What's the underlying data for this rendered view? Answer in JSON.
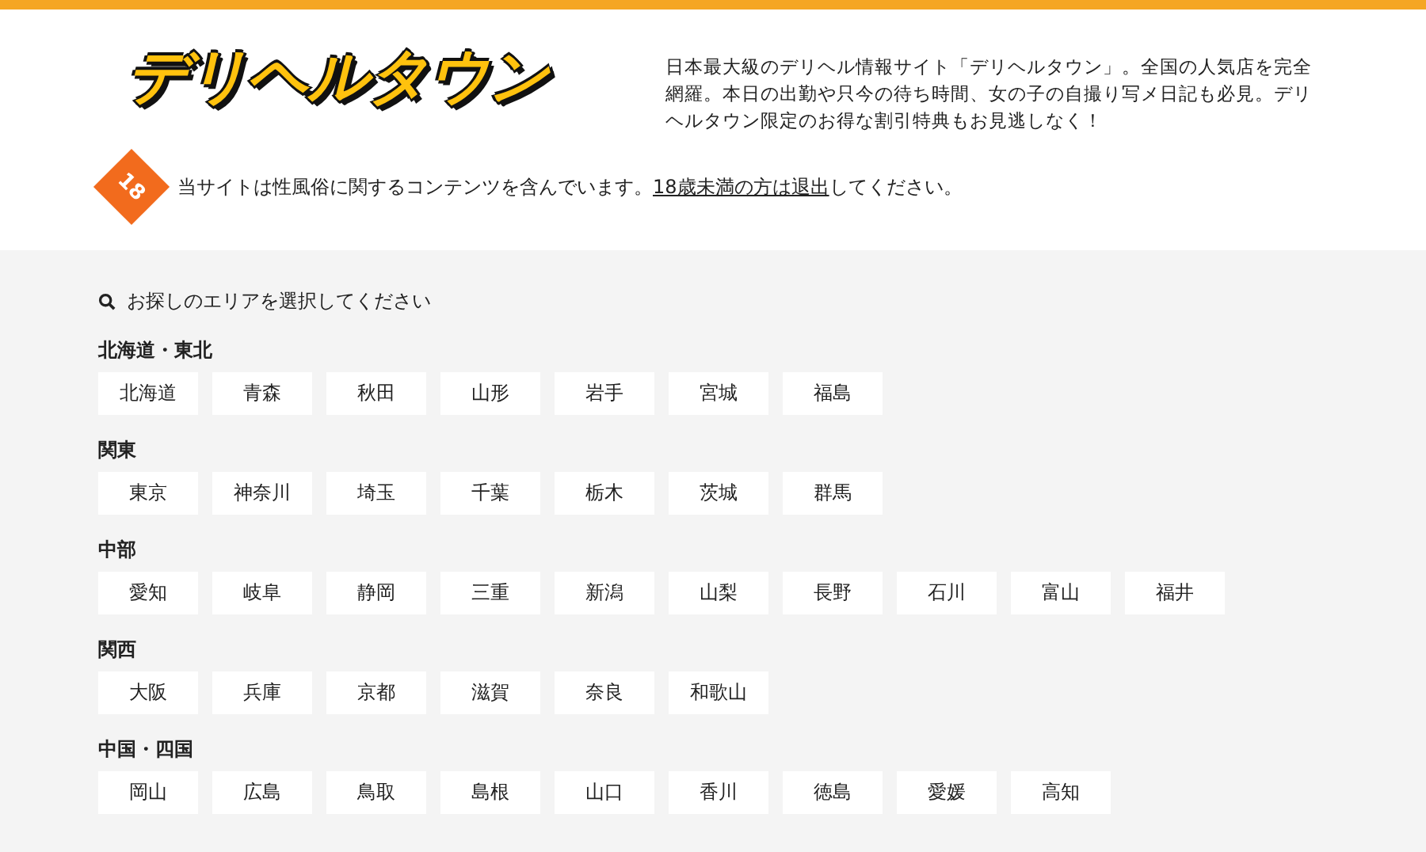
{
  "header": {
    "logo": "デリヘルタウン",
    "description": "日本最大級のデリヘル情報サイト「デリヘルタウン」。全国の人気店を完全網羅。本日の出勤や只今の待ち時間、女の子の自撮り写メ日記も必見。デリヘルタウン限定のお得な割引特典もお見逃しなく！",
    "age_badge": "18",
    "warning": {
      "before": "当サイトは性風俗に関するコンテンツを含んでいます。",
      "link": "18歳未満の方は退出",
      "after": "してください。"
    }
  },
  "area_search": {
    "heading": "お探しのエリアを選択してください",
    "regions": [
      {
        "name": "北海道・東北",
        "prefectures": [
          "北海道",
          "青森",
          "秋田",
          "山形",
          "岩手",
          "宮城",
          "福島"
        ]
      },
      {
        "name": "関東",
        "prefectures": [
          "東京",
          "神奈川",
          "埼玉",
          "千葉",
          "栃木",
          "茨城",
          "群馬"
        ]
      },
      {
        "name": "中部",
        "prefectures": [
          "愛知",
          "岐阜",
          "静岡",
          "三重",
          "新潟",
          "山梨",
          "長野",
          "石川",
          "富山",
          "福井"
        ]
      },
      {
        "name": "関西",
        "prefectures": [
          "大阪",
          "兵庫",
          "京都",
          "滋賀",
          "奈良",
          "和歌山"
        ]
      },
      {
        "name": "中国・四国",
        "prefectures": [
          "岡山",
          "広島",
          "鳥取",
          "島根",
          "山口",
          "香川",
          "徳島",
          "愛媛",
          "高知"
        ]
      }
    ]
  }
}
